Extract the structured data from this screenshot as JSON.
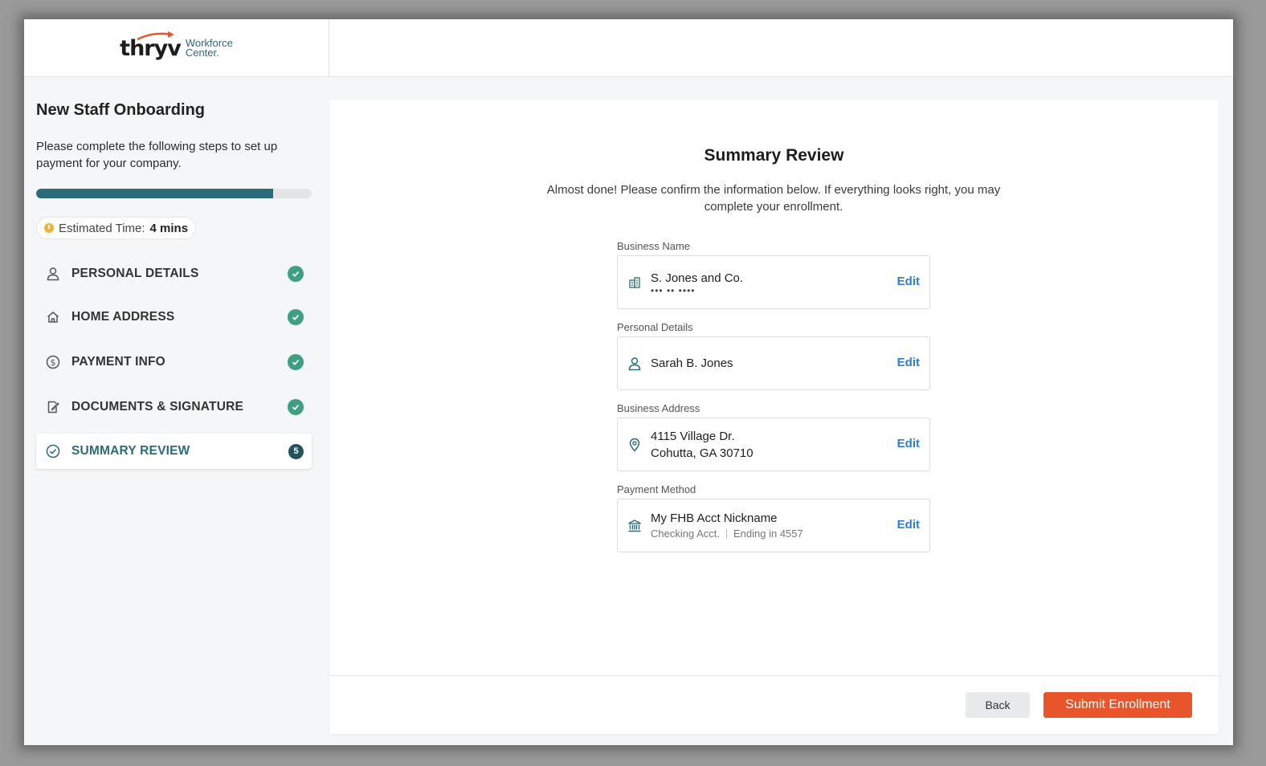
{
  "logo": {
    "word": "thryv",
    "sub1": "Workforce",
    "sub2": "Center."
  },
  "sidebar": {
    "title": "New Staff Onboarding",
    "description": "Please complete the following steps to set up payment for your company.",
    "progress_fraction": 0.86,
    "estimate_label": "Estimated Time:",
    "estimate_value": "4 mins",
    "steps": [
      {
        "label": "PERSONAL DETAILS",
        "icon": "person-icon",
        "status": "complete"
      },
      {
        "label": "HOME ADDRESS",
        "icon": "home-icon",
        "status": "complete"
      },
      {
        "label": "PAYMENT INFO",
        "icon": "dollar-icon",
        "status": "complete"
      },
      {
        "label": "DOCUMENTS & SIGNATURE",
        "icon": "document-sign-icon",
        "status": "complete"
      },
      {
        "label": "SUMMARY REVIEW",
        "icon": "check-circle-icon",
        "status": "active",
        "number": "5"
      }
    ]
  },
  "main": {
    "title": "Summary Review",
    "description": "Almost done! Please confirm the information below. If everything looks right, you may complete your enrollment.",
    "edit_label": "Edit",
    "business": {
      "label": "Business Name",
      "name": "S. Jones and Co.",
      "masked": "••• •• ••••"
    },
    "personal": {
      "label": "Personal Details",
      "name": "Sarah B. Jones"
    },
    "address": {
      "label": "Business Address",
      "line1": "4115 Village Dr.",
      "line2": "Cohutta, GA 30710"
    },
    "payment": {
      "label": "Payment Method",
      "nickname": "My FHB Acct Nickname",
      "type": "Checking Acct.",
      "ending": "Ending in 4557"
    }
  },
  "footer": {
    "back_label": "Back",
    "submit_label": "Submit Enrollment"
  },
  "colors": {
    "brand_teal": "#2a6b7a",
    "accent_orange": "#e8552a",
    "link_blue": "#2d7bd6",
    "check_green": "#3e9e86"
  }
}
